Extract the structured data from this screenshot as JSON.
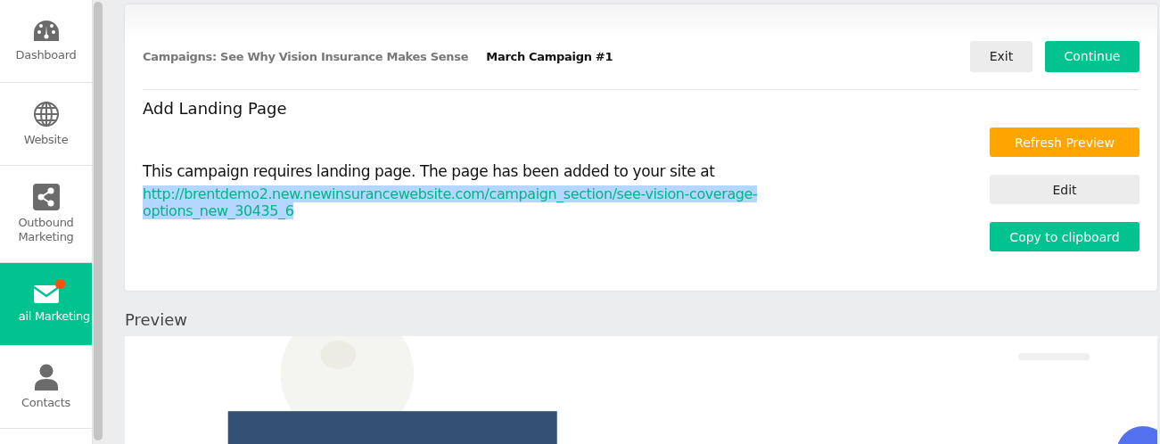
{
  "sidebar": {
    "items": [
      {
        "label": "Dashboard",
        "selected": false,
        "badge": false
      },
      {
        "label": "Website",
        "selected": false,
        "badge": false
      },
      {
        "label": "Outbound Marketing",
        "selected": false,
        "badge": false
      },
      {
        "label": "ail Marketing",
        "selected": true,
        "badge": true
      },
      {
        "label": "Contacts",
        "selected": false,
        "badge": false
      }
    ]
  },
  "header": {
    "breadcrumb": "Campaigns: See Why Vision Insurance Makes Sense",
    "campaign": "March Campaign #1",
    "buttons": [
      {
        "label": "Exit",
        "kind": "plain"
      },
      {
        "label": "Continue",
        "kind": "primary"
      }
    ]
  },
  "section": {
    "title": "Add Landing Page",
    "message": "This campaign requires landing page. The page has been added to your site at",
    "url": "http://brentdemo2.new.newinsurancewebsite.com/campaign_section/see-vision-coverage-options_new_30435_6",
    "buttons": [
      {
        "label": "Refresh Preview",
        "kind": "warning"
      },
      {
        "label": "Edit",
        "kind": "plain"
      },
      {
        "label": "Copy to clipboard",
        "kind": "primary"
      }
    ]
  },
  "preview": {
    "title": "Preview"
  }
}
